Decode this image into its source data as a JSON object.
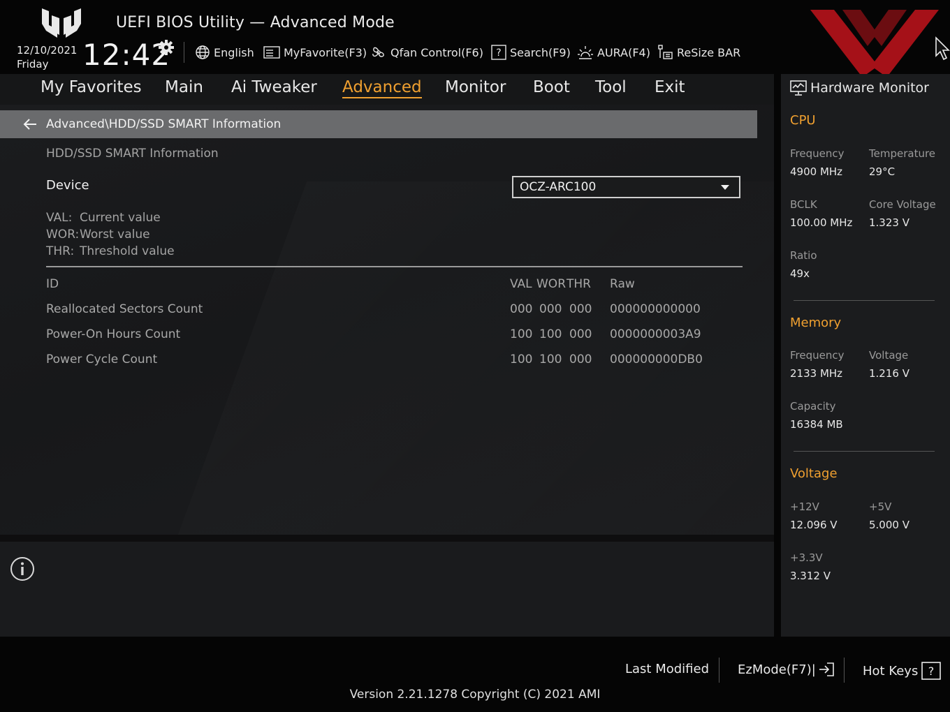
{
  "header": {
    "title": "UEFI BIOS Utility — Advanced Mode",
    "date": "12/10/2021",
    "day": "Friday",
    "time": "12:42",
    "tools": {
      "language": "English",
      "favorite": "MyFavorite(F3)",
      "qfan": "Qfan Control(F6)",
      "search": "Search(F9)",
      "aura": "AURA(F4)",
      "resize_bar": "ReSize BAR"
    }
  },
  "tabs": [
    {
      "label": "My Favorites",
      "active": false
    },
    {
      "label": "Main",
      "active": false
    },
    {
      "label": "Ai Tweaker",
      "active": false
    },
    {
      "label": "Advanced",
      "active": true
    },
    {
      "label": "Monitor",
      "active": false
    },
    {
      "label": "Boot",
      "active": false
    },
    {
      "label": "Tool",
      "active": false
    },
    {
      "label": "Exit",
      "active": false
    }
  ],
  "content": {
    "breadcrumb": "Advanced\\HDD/SSD SMART Information",
    "section_title": "HDD/SSD SMART Information",
    "device": {
      "label": "Device",
      "value": "OCZ-ARC100"
    },
    "legend": [
      {
        "key": "VAL:",
        "text": "Current value"
      },
      {
        "key": "WOR:",
        "text": "Worst value"
      },
      {
        "key": "THR:",
        "text": "Threshold value"
      }
    ],
    "table": {
      "headers": {
        "id": "ID",
        "val": "VAL",
        "wor": "WOR",
        "thr": "THR",
        "raw": "Raw"
      },
      "rows": [
        {
          "id": "Reallocated Sectors Count",
          "val": "000",
          "wor": "000",
          "thr": "000",
          "raw": "000000000000"
        },
        {
          "id": "Power-On Hours Count",
          "val": "100",
          "wor": "100",
          "thr": "000",
          "raw": "0000000003A9"
        },
        {
          "id": "Power Cycle Count",
          "val": "100",
          "wor": "100",
          "thr": "000",
          "raw": "000000000DB0"
        }
      ]
    }
  },
  "hardware_monitor": {
    "title": "Hardware Monitor",
    "cpu": {
      "title": "CPU",
      "frequency_label": "Frequency",
      "frequency": "4900 MHz",
      "temperature_label": "Temperature",
      "temperature": "29°C",
      "bclk_label": "BCLK",
      "bclk": "100.00 MHz",
      "core_voltage_label": "Core Voltage",
      "core_voltage": "1.323 V",
      "ratio_label": "Ratio",
      "ratio": "49x"
    },
    "memory": {
      "title": "Memory",
      "frequency_label": "Frequency",
      "frequency": "2133 MHz",
      "voltage_label": "Voltage",
      "voltage": "1.216 V",
      "capacity_label": "Capacity",
      "capacity": "16384 MB"
    },
    "voltage": {
      "title": "Voltage",
      "v12_label": "+12V",
      "v12": "12.096 V",
      "v5_label": "+5V",
      "v5": "5.000 V",
      "v33_label": "+3.3V",
      "v33": "3.312 V"
    }
  },
  "footer": {
    "last_modified": "Last Modified",
    "ezmode": "EzMode(F7)|",
    "hotkeys": "Hot Keys",
    "version": "Version 2.21.1278 Copyright (C) 2021 AMI"
  },
  "colors": {
    "accent": "#f0a030",
    "watermark": "#c0141c",
    "background": "#050505",
    "panel": "#1b1c1e",
    "breadcrumb_bar": "#6a6b6d"
  }
}
